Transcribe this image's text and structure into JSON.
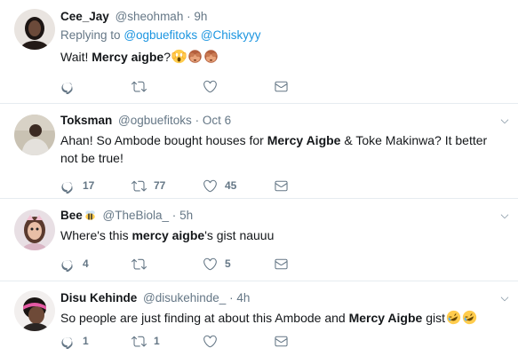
{
  "colors": {
    "link": "#1b95e0",
    "muted": "#657786",
    "text": "#14171a",
    "divider": "#e6ecf0"
  },
  "tweets": [
    {
      "name": "Cee_Jay",
      "handle": "@sheohmah",
      "sep": "·",
      "time": "9h",
      "reply_label": "Replying to",
      "reply_mentions": [
        "@ogbuefitoks",
        "@Chiskyyy"
      ],
      "text_parts": [
        "Wait! ",
        "Mercy aigbe",
        "?"
      ],
      "emojis": [
        "scream-emoji",
        "see-no-evil-monkey-emoji",
        "see-no-evil-monkey-emoji"
      ],
      "reply_count": "",
      "retweet_count": "",
      "like_count": ""
    },
    {
      "name": "Toksman",
      "handle": "@ogbuefitoks",
      "sep": "·",
      "time": "Oct 6",
      "text_parts": [
        "Ahan! So Ambode bought houses for ",
        "Mercy Aigbe",
        " & Toke Makinwa? It better not be true!"
      ],
      "reply_count": "17",
      "retweet_count": "77",
      "like_count": "45"
    },
    {
      "name": "Bee",
      "handle": "@TheBiola_",
      "sep": "·",
      "time": "5h",
      "name_emoji": "bee-emoji",
      "text_parts": [
        "Where's this ",
        "mercy aigbe",
        "'s gist nauuu"
      ],
      "reply_count": "4",
      "retweet_count": "",
      "like_count": "5"
    },
    {
      "name": "Disu Kehinde",
      "handle": "@disukehinde_",
      "sep": "·",
      "time": "4h",
      "text_parts": [
        "So people are just finding at about this Ambode and ",
        "Mercy Aigbe",
        " gist"
      ],
      "emojis": [
        "rofl-emoji",
        "rofl-emoji"
      ],
      "reply_count": "1",
      "retweet_count": "1",
      "like_count": ""
    }
  ]
}
